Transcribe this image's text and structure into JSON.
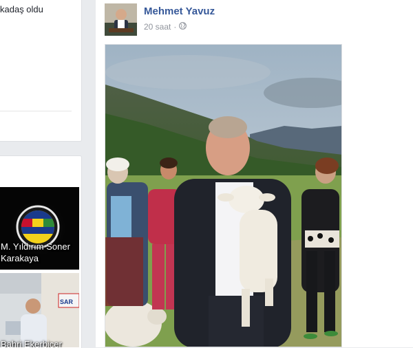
{
  "left_top": {
    "snippet": "kadaş oldu"
  },
  "friends": [
    {
      "name": "M. Yıldırım Soner Karakaya"
    },
    {
      "name": "Bahri Ekerbiçer"
    }
  ],
  "post": {
    "author": "Mehmet Yavuz",
    "time": "20 saat",
    "separator": "·",
    "privacy_icon": "globe-icon"
  },
  "colors": {
    "author_link": "#365899",
    "meta_gray": "#90949c",
    "page_bg": "#e9ebee"
  }
}
